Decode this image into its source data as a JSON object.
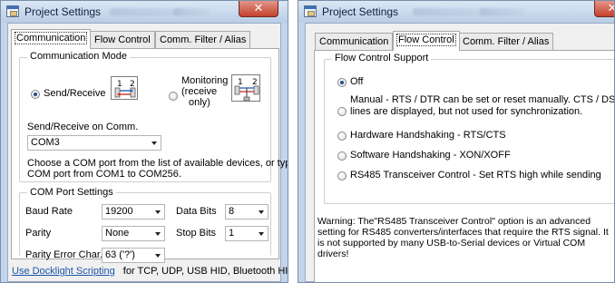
{
  "left_dialog": {
    "title": "Project Settings",
    "close_glyph": "✕",
    "tabs": [
      "Communication",
      "Flow Control",
      "Comm. Filter / Alias"
    ],
    "active_tab": "Communication",
    "communication_mode": {
      "group_title": "Communication Mode",
      "send_receive_label": "Send/Receive",
      "send_receive_checked": true,
      "monitoring_label_line1": "Monitoring",
      "monitoring_label_line2": "(receive",
      "monitoring_label_line3": "only)",
      "monitoring_checked": false,
      "icon_send_receive": "send-receive-device-icon",
      "icon_monitoring": "monitoring-device-icon",
      "diagram_digits": [
        "1",
        "2"
      ],
      "port_label": "Send/Receive on Comm.",
      "port_value": "COM3",
      "help_line1": "Choose a COM port from the list of available devices, or type a",
      "help_line2": "COM port from COM1 to COM256."
    },
    "com_port_settings": {
      "group_title": "COM Port Settings",
      "baud_rate_label": "Baud Rate",
      "baud_rate_value": "19200",
      "data_bits_label": "Data Bits",
      "data_bits_value": "8",
      "parity_label": "Parity",
      "parity_value": "None",
      "stop_bits_label": "Stop Bits",
      "stop_bits_value": "1",
      "parity_error_label": "Parity Error Char.",
      "parity_error_value": "63 ('?')"
    },
    "footer_link": "Use Docklight Scripting",
    "footer_text": "for TCP, UDP, USB HID, Bluetooth HID"
  },
  "right_dialog": {
    "title": "Project Settings",
    "close_glyph": "✕",
    "tabs": [
      "Communication",
      "Flow Control",
      "Comm. Filter / Alias"
    ],
    "active_tab": "Flow Control",
    "flow_control": {
      "group_title": "Flow Control Support",
      "options": [
        {
          "label": "Off",
          "checked": true
        },
        {
          "label_line1": "Manual  -  RTS / DTR can be set or reset manually. CTS / DSR",
          "label_line2": "lines are displayed, but not used for synchronization.",
          "checked": false
        },
        {
          "label": "Hardware Handshaking - RTS/CTS",
          "checked": false
        },
        {
          "label": "Software Handshaking  -  XON/XOFF",
          "checked": false
        },
        {
          "label": "RS485 Transceiver Control - Set RTS high while sending",
          "checked": false
        }
      ]
    },
    "warning_text": "Warning: The\"RS485 Transceiver Control\" option is an advanced setting for RS485 converters/interfaces that require the RTS signal. It is not supported by many USB-to-Serial devices or Virtual COM drivers!"
  },
  "colors": {
    "window_frame": "#c3d5ea",
    "close_button": "#c4412c",
    "link": "#1a55a7",
    "radio_dot": "#1d4f8f"
  }
}
